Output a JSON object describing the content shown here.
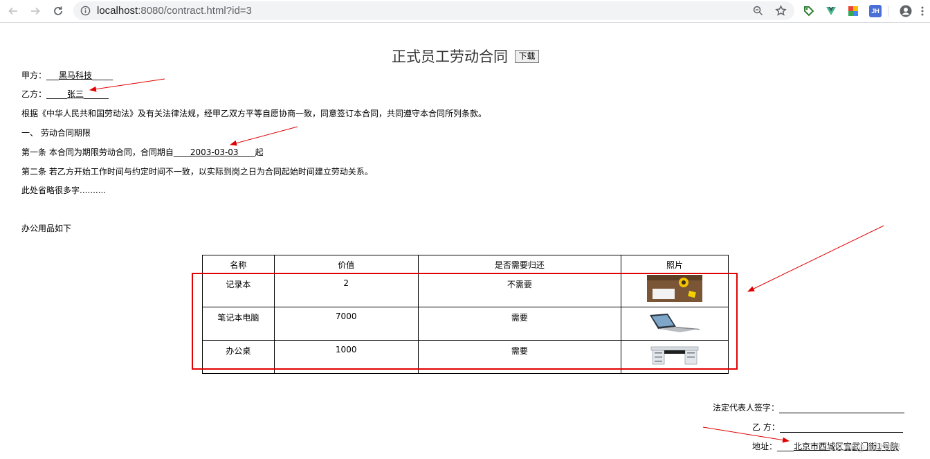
{
  "browser": {
    "url_host": "localhost",
    "url_path": ":8080/contract.html?id=3",
    "extensions": [
      "tag-extension-icon",
      "vue-devtools-icon",
      "colorful-extension-icon",
      "jh-extension-icon"
    ],
    "jh_label": "JH"
  },
  "contract": {
    "title": "正式员工劳动合同",
    "download_label": "下载",
    "party_a": {
      "prefix": "甲方：___",
      "name": "黑马科技",
      "suffix": "_____"
    },
    "party_b": {
      "prefix": "乙方：_____",
      "name": "张三",
      "suffix": "______"
    },
    "intro": "根据《中华人民共和国劳动法》及有关法律法规，经甲乙双方平等自愿协商一致，同意签订本合同，共同遵守本合同所列条款。",
    "section_1": "一、  劳动合同期限",
    "article_1": {
      "prefix": "第一条 本合同为期限劳动合同，合同期自____",
      "date": "2003-03-03",
      "suffix": "____起"
    },
    "article_2": "第二条 若乙方开始工作时间与约定时间不一致，以实际到岗之日为合同起始时间建立劳动关系。",
    "omitted": "此处省略很多字..........",
    "supplies_heading": "办公用品如下"
  },
  "table": {
    "headers": [
      "名称",
      "价值",
      "是否需要归还",
      "照片"
    ],
    "rows": [
      {
        "name": "记录本",
        "value": "2",
        "return": "不需要",
        "photo": "notebook-photo"
      },
      {
        "name": "笔记本电脑",
        "value": "7000",
        "return": "需要",
        "photo": "laptop-photo"
      },
      {
        "name": "办公桌",
        "value": "1000",
        "return": "需要",
        "photo": "desk-photo"
      }
    ]
  },
  "signature": {
    "legal_rep_label": "法定代表人签字：",
    "party_b_label": "乙 方：",
    "address_label": "地址：____",
    "address_value": "北京市西城区宣武门街1号院"
  },
  "watermark": "CSDN @七月将尽",
  "colors": {
    "annotation_red": "#e00000",
    "omnibox_bg": "#f1f3f4"
  }
}
